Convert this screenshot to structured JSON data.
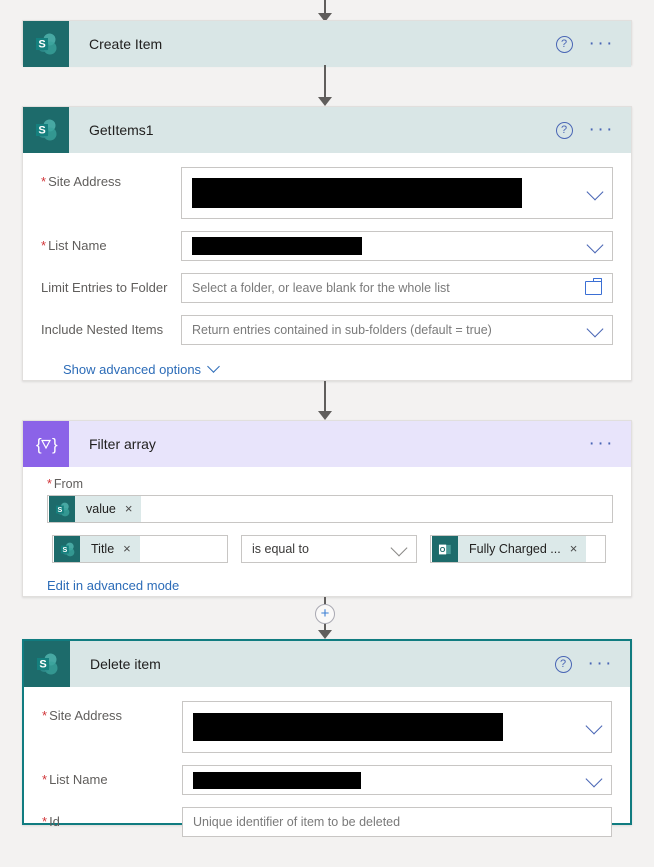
{
  "flow": {
    "cards": [
      {
        "id": "create-item",
        "title": "Create Item",
        "icon": "sharepoint-icon",
        "help_label": "?",
        "menu_label": "···",
        "accent": "#1d6b6b",
        "header_bg": "#d9e6e6"
      },
      {
        "id": "get-items-1",
        "title": "GetItems1",
        "icon": "sharepoint-icon",
        "help_label": "?",
        "menu_label": "···",
        "accent": "#1d6b6b",
        "header_bg": "#d9e6e6",
        "fields": [
          {
            "label": "Site Address",
            "required": true,
            "value": "[redacted]",
            "redacted": true,
            "control": "dropdown"
          },
          {
            "label": "List Name",
            "required": true,
            "value": "[redacted]",
            "redacted": true,
            "control": "dropdown"
          },
          {
            "label": "Limit Entries to Folder",
            "required": false,
            "placeholder": "Select a folder, or leave blank for the whole list",
            "control": "folder-picker"
          },
          {
            "label": "Include Nested Items",
            "required": false,
            "placeholder": "Return entries contained in sub-folders (default = true)",
            "control": "dropdown"
          }
        ],
        "advanced_link": "Show advanced options"
      },
      {
        "id": "filter-array",
        "title": "Filter array",
        "icon": "filter-array-icon",
        "menu_label": "···",
        "accent": "#8b63e8",
        "header_bg": "#e8e4fb",
        "from_label": "From",
        "from_required": true,
        "from_token": {
          "text": "value",
          "icon": "sharepoint-icon",
          "remove_label": "×"
        },
        "condition": {
          "left_token": {
            "text": "Title",
            "icon": "sharepoint-icon",
            "remove_label": "×"
          },
          "operator": "is equal to",
          "right_token": {
            "text": "Fully Charged ...",
            "icon": "office-outlook-icon",
            "remove_label": "×"
          }
        },
        "advanced_link": "Edit in advanced mode"
      },
      {
        "id": "delete-item",
        "title": "Delete item",
        "icon": "sharepoint-icon",
        "help_label": "?",
        "menu_label": "···",
        "accent": "#1d6b6b",
        "header_bg": "#d9e6e6",
        "selected": true,
        "fields": [
          {
            "label": "Site Address",
            "required": true,
            "value": "[redacted]",
            "redacted": true,
            "control": "dropdown"
          },
          {
            "label": "List Name",
            "required": true,
            "value": "[redacted]",
            "redacted": true,
            "control": "dropdown"
          },
          {
            "label": "Id",
            "required": true,
            "placeholder": "Unique identifier of item to be deleted",
            "control": "text"
          }
        ]
      }
    ],
    "insert_button_label": "+",
    "required_marker": "*"
  }
}
